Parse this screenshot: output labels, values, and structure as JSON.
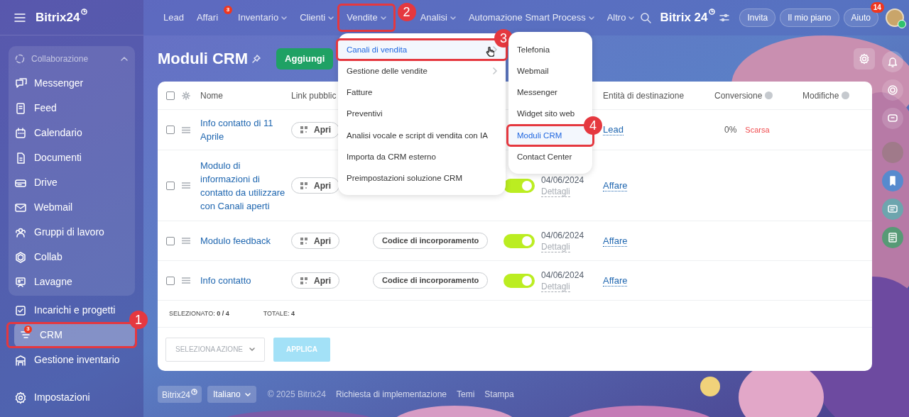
{
  "sidebar": {
    "logo": "Bitrix24",
    "group": {
      "title": "Collaborazione",
      "expanded": true,
      "items": [
        {
          "label": "Messenger",
          "selected": false
        },
        {
          "label": "Feed",
          "selected": false
        },
        {
          "label": "Calendario",
          "selected": false
        },
        {
          "label": "Documenti",
          "selected": false
        },
        {
          "label": "Drive",
          "selected": false
        },
        {
          "label": "Webmail",
          "selected": false
        },
        {
          "label": "Gruppi di lavoro",
          "selected": false
        },
        {
          "label": "Collab",
          "selected": false
        },
        {
          "label": "Lavagne",
          "selected": false
        }
      ]
    },
    "items": [
      {
        "label": "Incarichi e progetti",
        "selected": false
      },
      {
        "label": "CRM",
        "selected": true,
        "badge": "3",
        "callout": "1"
      },
      {
        "label": "Gestione inventario",
        "selected": false
      }
    ],
    "settings": "Impostazioni"
  },
  "topnav": {
    "items": [
      {
        "label": "Lead",
        "dropdown": false
      },
      {
        "label": "Affari",
        "dropdown": false,
        "badge": "3"
      },
      {
        "label": "Inventario",
        "dropdown": true
      },
      {
        "label": "Clienti",
        "dropdown": true
      },
      {
        "label": "Vendite",
        "dropdown": true,
        "callout": "2"
      },
      {
        "label": "Analisi",
        "dropdown": true
      },
      {
        "label": "Automazione Smart Process",
        "dropdown": true
      },
      {
        "label": "Altro",
        "dropdown": true
      }
    ],
    "logo": "Bitrix 24",
    "buttons": [
      {
        "label": "Invita"
      },
      {
        "label": "Il mio piano"
      },
      {
        "label": "Aiuto",
        "badge": "14"
      }
    ]
  },
  "page": {
    "title": "Moduli CRM",
    "add_button": "Aggiungi"
  },
  "table": {
    "header_checked": false,
    "columns": [
      {
        "label": "Nome",
        "help": false
      },
      {
        "label": "Link pubblic",
        "help": false
      },
      {
        "label": "Entità di destinazione",
        "help": false
      },
      {
        "label": "Conversione",
        "help": true
      },
      {
        "label": "Modifiche",
        "help": true
      }
    ],
    "rows": [
      {
        "name": "Info contatto di 11 Aprile",
        "checked": false,
        "open": "Apri",
        "entity": "Lead",
        "conversion": "0%",
        "rating": "Scarsa"
      },
      {
        "name": "Modulo di informazioni di contatto da utilizzare con Canali aperti",
        "checked": false,
        "open": "Apri",
        "active": true,
        "date": "04/06/2024",
        "details": "Dettagli",
        "entity": "Affare"
      },
      {
        "name": "Modulo feedback",
        "checked": false,
        "open": "Apri",
        "embed": "Codice di incorporamento",
        "active": true,
        "date": "04/06/2024",
        "details": "Dettagli",
        "entity": "Affare"
      },
      {
        "name": "Info contatto",
        "checked": false,
        "open": "Apri",
        "embed": "Codice di incorporamento",
        "active": true,
        "date": "04/06/2024",
        "details": "Dettagli",
        "entity": "Affare"
      }
    ],
    "summary": {
      "selected_label": "SELEZIONATO:",
      "selected_value": "0 / 4",
      "total_label": "TOTALE:",
      "total_value": "4"
    },
    "actions": {
      "select_placeholder": "SELEZIONA AZIONE",
      "apply": "APPLICA",
      "apply_disabled": true
    }
  },
  "menu": {
    "items": [
      {
        "label": "Canali di vendita",
        "selected": true,
        "submenu": true,
        "callout": "3"
      },
      {
        "label": "Gestione delle vendite",
        "selected": false,
        "submenu": true
      },
      {
        "label": "Fatture",
        "selected": false,
        "submenu": false
      },
      {
        "label": "Preventivi",
        "selected": false,
        "submenu": false
      },
      {
        "label": "Analisi vocale e script di vendita con IA",
        "selected": false,
        "submenu": false
      },
      {
        "label": "Importa da CRM esterno",
        "selected": false,
        "submenu": false
      },
      {
        "label": "Preimpostazioni soluzione CRM",
        "selected": false,
        "submenu": false
      }
    ]
  },
  "submenu": {
    "items": [
      {
        "label": "Telefonia",
        "selected": false
      },
      {
        "label": "Webmail",
        "selected": false
      },
      {
        "label": "Messenger",
        "selected": false
      },
      {
        "label": "Widget sito web",
        "selected": false
      },
      {
        "label": "Moduli CRM",
        "selected": true,
        "callout": "4"
      },
      {
        "label": "Contact Center",
        "selected": false
      }
    ]
  },
  "footer": {
    "logo": "Bitrix24",
    "language": "Italiano",
    "copyright": "© 2025 Bitrix24",
    "links": [
      "Richiesta di implementazione",
      "Temi",
      "Stampa"
    ]
  }
}
